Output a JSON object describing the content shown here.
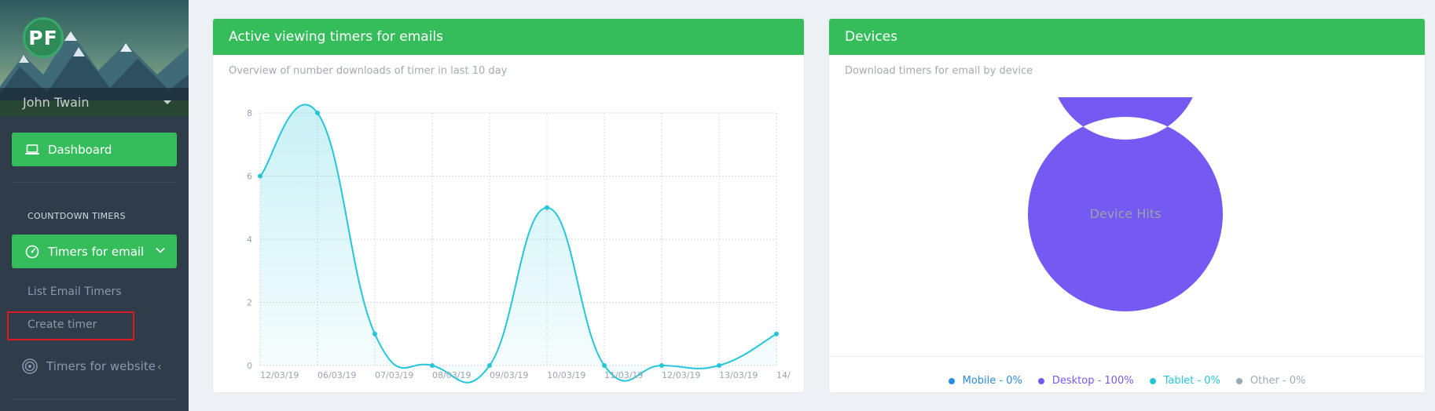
{
  "profile": {
    "initials": "PF",
    "name": "John Twain"
  },
  "sidebar": {
    "dashboard": {
      "label": "Dashboard",
      "icon": "laptop-icon"
    },
    "section_label": "COUNTDOWN TIMERS",
    "timers_email": {
      "label": "Timers for email",
      "icon": "speedometer-icon"
    },
    "list_email_timers": "List Email Timers",
    "create_timer": "Create timer",
    "timers_website": {
      "label": "Timers for website",
      "icon": "target-icon"
    }
  },
  "colors": {
    "accent": "#36bd5b",
    "sidebar": "#2f3d4a",
    "line": "#26c6da",
    "donut": "#745af2",
    "highlight": "#e01a22"
  },
  "line_card": {
    "title": "Active viewing timers for emails",
    "subtitle": "Overview of number downloads of timer in last 10 day"
  },
  "devices_card": {
    "title": "Devices",
    "subtitle": "Download timers for email by device",
    "center_label": "Device Hits",
    "legend": [
      {
        "label": "Mobile - 0%",
        "color": "#2a8be6"
      },
      {
        "label": "Desktop - 100%",
        "color": "#745af2"
      },
      {
        "label": "Tablet - 0%",
        "color": "#26c6da"
      },
      {
        "label": "Other - 0%",
        "color": "#99abb4"
      }
    ]
  },
  "chart_data": [
    {
      "type": "area",
      "title": "",
      "categories": [
        "12/03/19",
        "06/03/19",
        "07/03/19",
        "08/03/19",
        "09/03/19",
        "10/03/19",
        "11/03/19",
        "12/03/19",
        "13/03/19",
        "14/"
      ],
      "values": [
        6,
        8,
        1,
        0,
        0,
        5,
        0,
        0,
        0,
        1
      ],
      "yticks": [
        0,
        2,
        4,
        6,
        8
      ],
      "ylim": [
        0,
        8
      ],
      "grid": true,
      "color": "#26c6da"
    },
    {
      "type": "pie",
      "title": "",
      "labels": [
        "Mobile",
        "Desktop",
        "Tablet",
        "Other"
      ],
      "values": [
        0,
        100,
        0,
        0
      ],
      "colors": [
        "#2a8be6",
        "#745af2",
        "#26c6da",
        "#99abb4"
      ]
    }
  ]
}
